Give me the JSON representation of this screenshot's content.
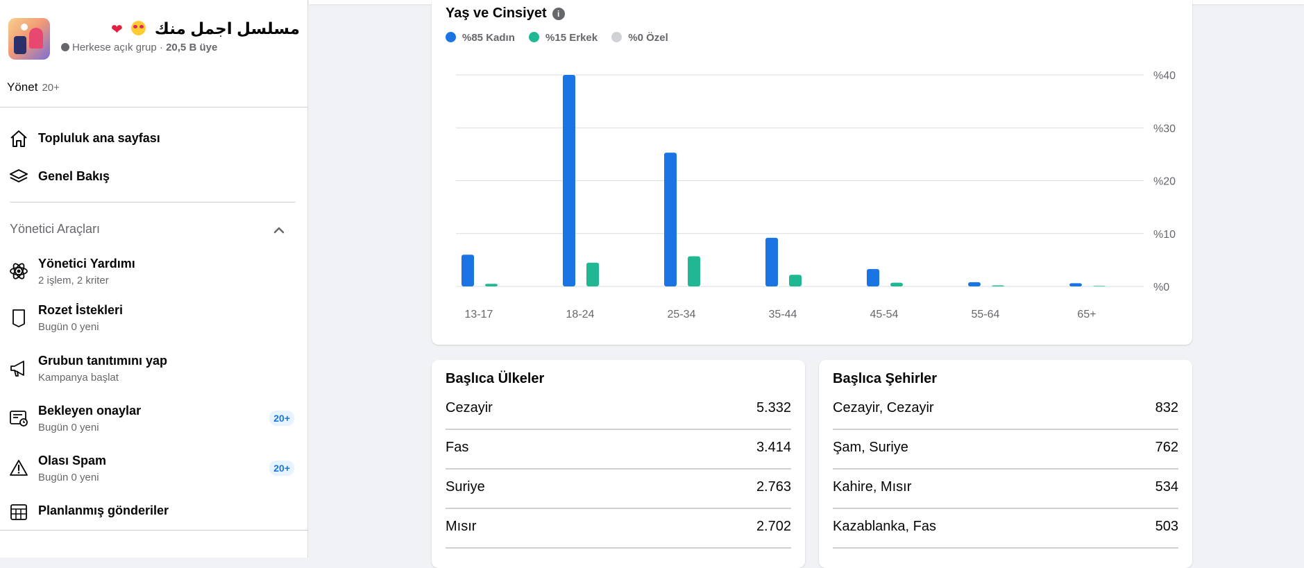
{
  "group": {
    "name": "مسلسل اجمل منك",
    "privacy": "Herkese açık grup",
    "separator": " · ",
    "members": "20,5 B üye"
  },
  "manage": {
    "label": "Yönet",
    "count": "20+"
  },
  "nav": [
    {
      "label": "Topluluk ana sayfası",
      "icon": "home-icon"
    },
    {
      "label": "Genel Bakış",
      "icon": "layers-icon"
    }
  ],
  "admin_tools": {
    "title": "Yönetici Araçları",
    "items": [
      {
        "label": "Yönetici Yardımı",
        "sub": "2 işlem, 2 kriter",
        "icon": "atom-gear-icon"
      },
      {
        "label": "Rozet İstekleri",
        "sub": "Bugün 0 yeni",
        "icon": "badge-icon"
      },
      {
        "label": "Grubun tanıtımını yap",
        "sub": "Kampanya başlat",
        "icon": "megaphone-icon"
      },
      {
        "label": "Bekleyen onaylar",
        "sub": "Bugün 0 yeni",
        "badge": "20+",
        "icon": "pending-approvals-icon"
      },
      {
        "label": "Olası Spam",
        "sub": "Bugün 0 yeni",
        "badge": "20+",
        "icon": "warning-icon"
      },
      {
        "label": "Planlanmış gönderiler",
        "icon": "calendar-icon"
      }
    ]
  },
  "colors": {
    "female": "#1b74e4",
    "male": "#1fb892",
    "other": "#cfd1d5"
  },
  "chart_data": {
    "type": "bar",
    "title": "Yaş ve Cinsiyet",
    "legend": [
      "%85 Kadın",
      "%15 Erkek",
      "%0 Özel"
    ],
    "legend_placement": "top-left",
    "categories": [
      "13-17",
      "18-24",
      "25-34",
      "35-44",
      "45-54",
      "55-64",
      "65+"
    ],
    "series": [
      {
        "name": "%85 Kadın",
        "values": [
          6,
          40,
          25.3,
          9.2,
          3.3,
          0.8,
          0.6
        ]
      },
      {
        "name": "%15 Erkek",
        "values": [
          0.5,
          4.5,
          5.7,
          2.2,
          0.7,
          0.2,
          0.1
        ]
      },
      {
        "name": "%0 Özel",
        "values": [
          0,
          0,
          0,
          0,
          0,
          0,
          0
        ]
      }
    ],
    "ylim": [
      0,
      40
    ],
    "yticks": [
      "%0",
      "%10",
      "%20",
      "%30",
      "%40"
    ],
    "grid": true
  },
  "countries": {
    "title": "Başlıca Ülkeler",
    "rows": [
      {
        "name": "Cezayir",
        "value": "5.332"
      },
      {
        "name": "Fas",
        "value": "3.414"
      },
      {
        "name": "Suriye",
        "value": "2.763"
      },
      {
        "name": "Mısır",
        "value": "2.702"
      }
    ]
  },
  "cities": {
    "title": "Başlıca Şehirler",
    "rows": [
      {
        "name": "Cezayir, Cezayir",
        "value": "832"
      },
      {
        "name": "Şam, Suriye",
        "value": "762"
      },
      {
        "name": "Kahire, Mısır",
        "value": "534"
      },
      {
        "name": "Kazablanka, Fas",
        "value": "503"
      }
    ]
  }
}
